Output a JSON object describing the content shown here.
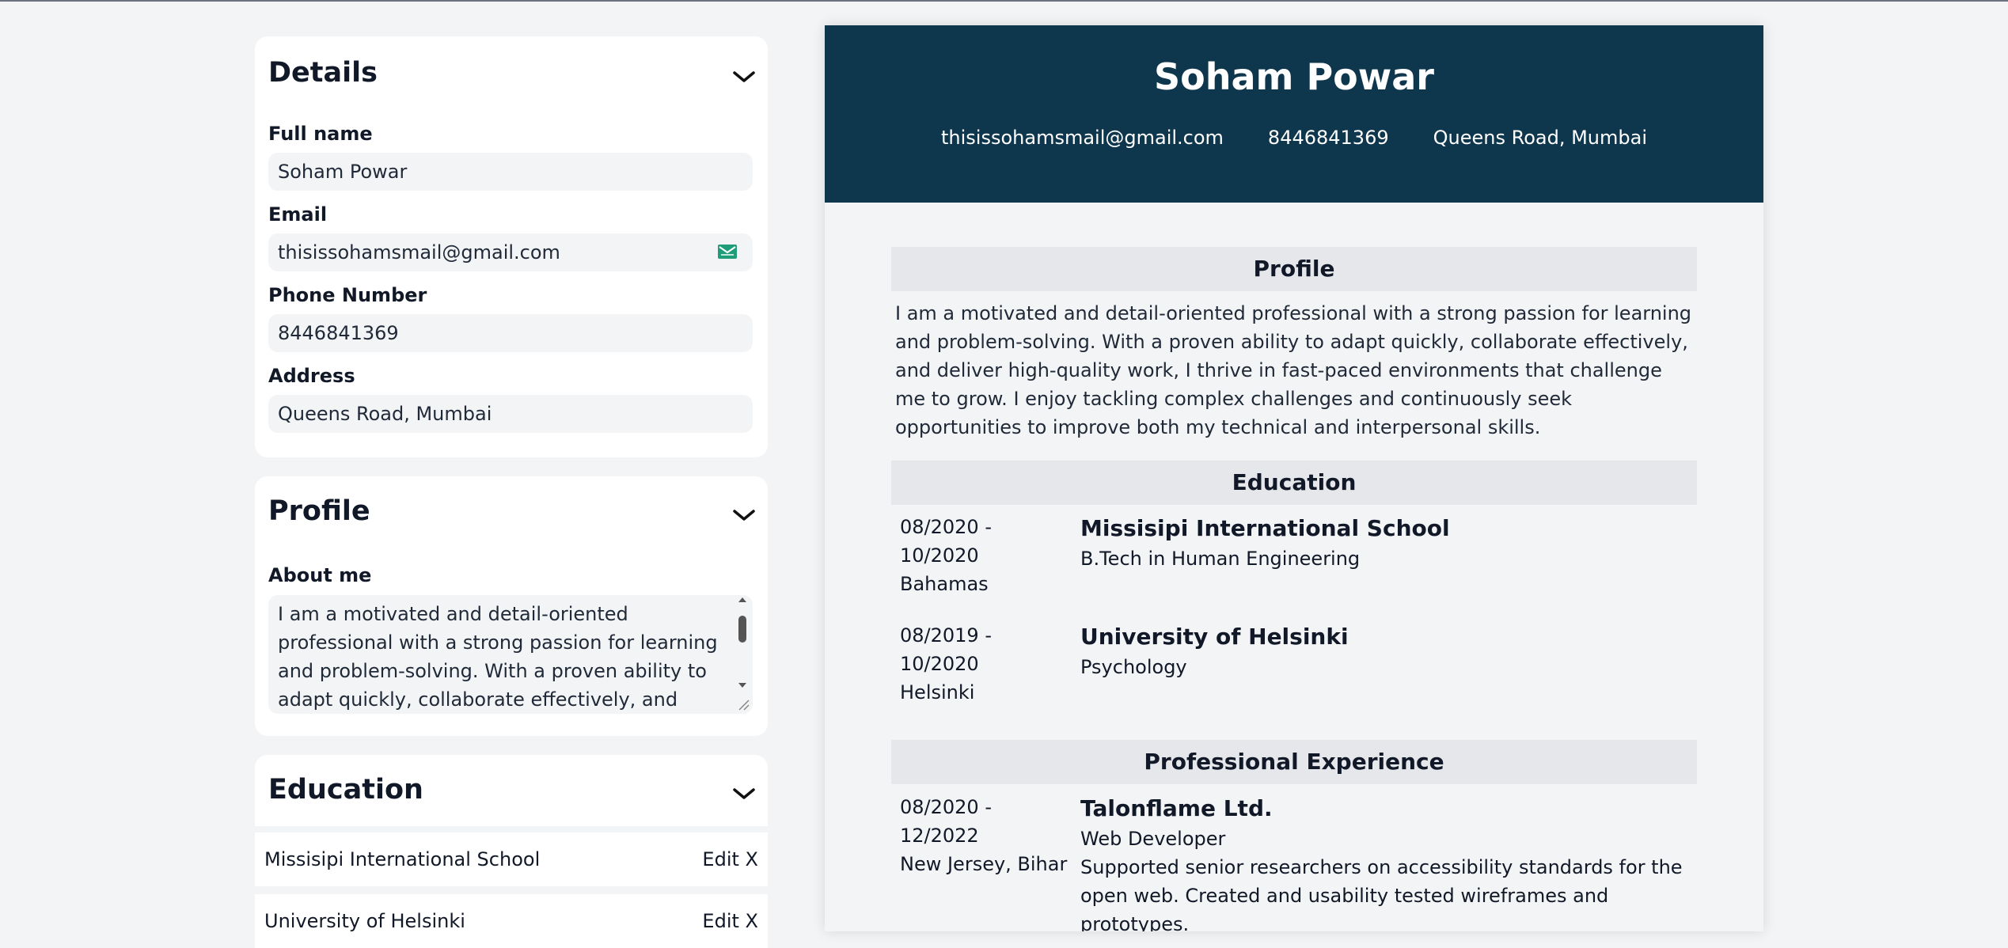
{
  "details": {
    "title": "Details",
    "fullname_label": "Full name",
    "fullname_value": "Soham Powar",
    "email_label": "Email",
    "email_value": "thisissohamsmail@gmail.com",
    "phone_label": "Phone Number",
    "phone_value": "8446841369",
    "address_label": "Address",
    "address_value": "Queens Road, Mumbai"
  },
  "profile": {
    "title": "Profile",
    "about_label": "About me",
    "about_value": "I am a motivated and detail-oriented professional with a strong passion for learning and problem-solving. With a proven ability to adapt quickly, collaborate effectively, and deliver high-quality"
  },
  "education_panel": {
    "title": "Education",
    "items": [
      {
        "name": "Missisipi International School",
        "edit": "Edit",
        "remove": "X"
      },
      {
        "name": "University of Helsinki",
        "edit": "Edit",
        "remove": "X"
      }
    ]
  },
  "resume": {
    "name": "Soham Powar",
    "email": "thisissohamsmail@gmail.com",
    "phone": "8446841369",
    "address": "Queens Road, Mumbai",
    "profile_heading": "Profile",
    "profile_text": "I am a motivated and detail-oriented professional with a strong passion for learning and problem-solving. With a proven ability to adapt quickly, collaborate effectively, and deliver high-quality work, I thrive in fast-paced environments that challenge me to grow. I enjoy tackling complex challenges and continuously seek opportunities to improve both my technical and interpersonal skills.",
    "education_heading": "Education",
    "education": [
      {
        "start": "08/2020 -",
        "end": "10/2020",
        "location": "Bahamas",
        "school": "Missisipi International School",
        "degree": "B.Tech in Human Engineering"
      },
      {
        "start": "08/2019 -",
        "end": "10/2020",
        "location": "Helsinki",
        "school": "University of Helsinki",
        "degree": "Psychology"
      }
    ],
    "experience_heading": "Professional Experience",
    "experience": [
      {
        "start": "08/2020 -",
        "end": "12/2022",
        "location": "New Jersey, Bihar",
        "company": "Talonflame Ltd.",
        "role": "Web Developer",
        "description": "Supported senior researchers on accessibility standards for the open web. Created and usability tested wireframes and prototypes."
      }
    ]
  },
  "colors": {
    "header_bg": "#0e374e",
    "page_bg": "#f3f4f6",
    "section_bar": "#e5e7eb"
  },
  "icons": [
    "chevron-down-icon",
    "mail-icon"
  ]
}
